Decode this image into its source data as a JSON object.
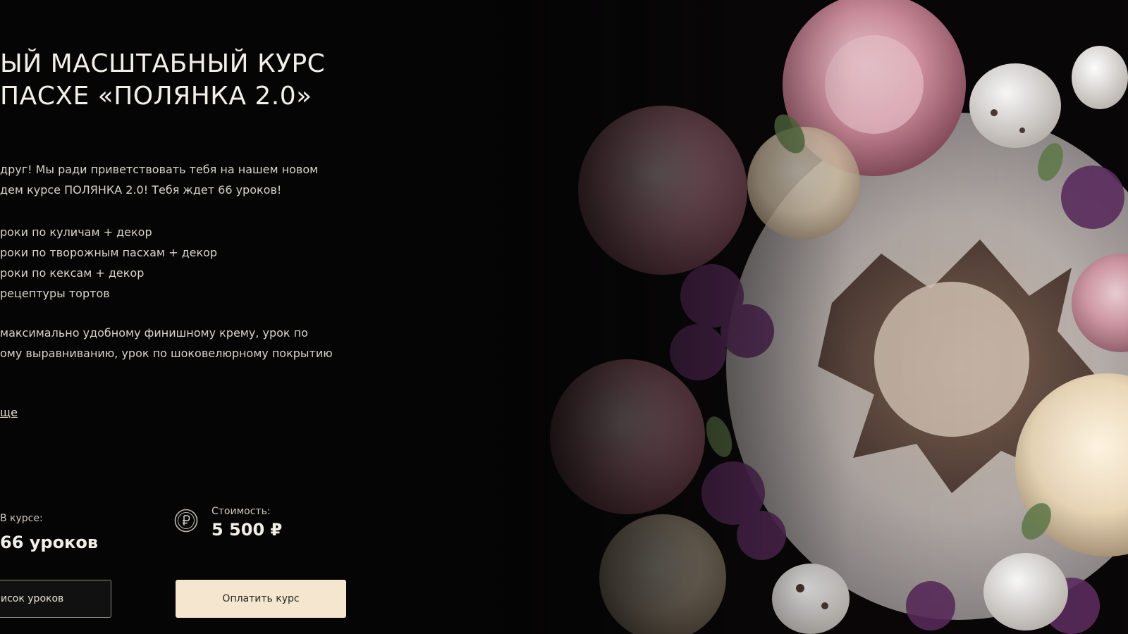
{
  "hero": {
    "title_line1": "ЫЙ МАСШТАБНЫЙ КУРС",
    "title_line2": "ПАСХЕ «ПОЛЯНКА 2.0»",
    "intro_line1": "друг! Мы ради приветствовать тебя на нашем новом",
    "intro_line2": "дем курсе ПОЛЯНКА 2.0! Тебя ждет 66 уроков!",
    "lessons": [
      "роки по куличам + декор",
      "роки по творожным пасхам + декор",
      "роки по кексам + декор",
      "рецептуры тортов"
    ],
    "extra_line1": "максимально удобному финишному крему, урок по",
    "extra_line2": "ому выравниванию, урок по шоковелюрному покрытию",
    "more_link": "ще"
  },
  "stats": {
    "lessons_label": "В курсе:",
    "lessons_value": "66 уроков",
    "price_label": "Стоимость:",
    "price_value": "5 500 ₽",
    "price_icon": "ruble-coin-icon"
  },
  "buttons": {
    "lessons_list": "исок уроков",
    "pay": "Оплатить курс"
  },
  "colors": {
    "background": "#050505",
    "pay_button": "#f4e6cf",
    "text": "#e8e3da"
  }
}
